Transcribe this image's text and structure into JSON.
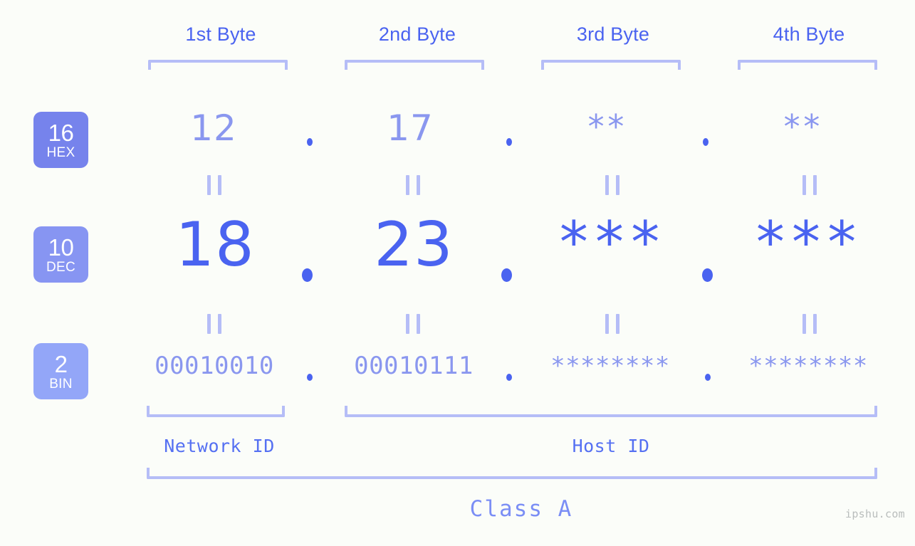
{
  "background_color": "#fbfdf9",
  "accent_colors": {
    "strong_blue": "#4a63f0",
    "mid_blue": "#8a97ef",
    "light_blue": "#b5bdf7",
    "badge_hex": "#7683ec",
    "badge_dec": "#8795f2",
    "badge_bin": "#93a6f8",
    "watermark_gray": "#b9bdbc"
  },
  "byte_headers": [
    {
      "label": "1st Byte"
    },
    {
      "label": "2nd Byte"
    },
    {
      "label": "3rd Byte"
    },
    {
      "label": "4th Byte"
    }
  ],
  "bases": [
    {
      "number": "16",
      "name": "HEX"
    },
    {
      "number": "10",
      "name": "DEC"
    },
    {
      "number": "2",
      "name": "BIN"
    }
  ],
  "rows": {
    "hex": {
      "base_number": "16",
      "base_name": "HEX",
      "values": [
        "12",
        "17",
        "**",
        "**"
      ]
    },
    "dec": {
      "base_number": "10",
      "base_name": "DEC",
      "values": [
        "18",
        "23",
        "***",
        "***"
      ]
    },
    "bin": {
      "base_number": "2",
      "base_name": "BIN",
      "values": [
        "00010010",
        "00010111",
        "********",
        "********"
      ]
    }
  },
  "separators": {
    "hex": ".",
    "dec": ".",
    "bin": "."
  },
  "equality_marks": "||",
  "segments": [
    {
      "label": "Network ID",
      "bytes": 1
    },
    {
      "label": "Host ID",
      "bytes": 3
    }
  ],
  "class_label": "Class A",
  "watermark": "ipshu.com"
}
